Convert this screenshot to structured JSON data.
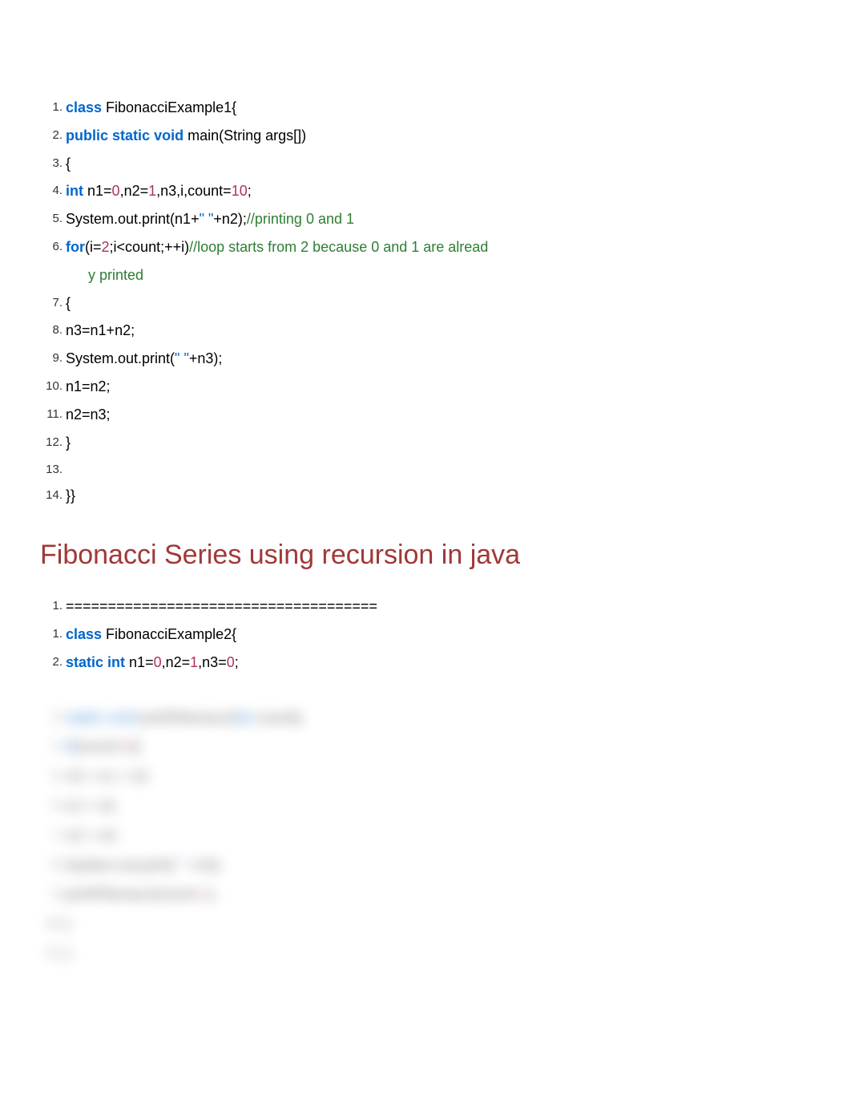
{
  "code_block_1": {
    "lines": [
      {
        "n": "1.",
        "tokens": [
          {
            "t": "class",
            "c": "kw"
          },
          {
            "t": " FibonacciExample1{",
            "c": ""
          }
        ]
      },
      {
        "n": "2.",
        "tokens": [
          {
            "t": "public",
            "c": "kw"
          },
          {
            "t": " ",
            "c": ""
          },
          {
            "t": "static",
            "c": "kw"
          },
          {
            "t": " ",
            "c": ""
          },
          {
            "t": "void",
            "c": "kw"
          },
          {
            "t": " main(String args[])",
            "c": ""
          }
        ]
      },
      {
        "n": "3.",
        "tokens": [
          {
            "t": " {",
            "c": ""
          }
        ]
      },
      {
        "n": "4.",
        "tokens": [
          {
            "t": " ",
            "c": ""
          },
          {
            "t": "int",
            "c": "kw"
          },
          {
            "t": " n1=",
            "c": ""
          },
          {
            "t": "0",
            "c": "num"
          },
          {
            "t": ",n2=",
            "c": ""
          },
          {
            "t": "1",
            "c": "num"
          },
          {
            "t": ",n3,i,count=",
            "c": ""
          },
          {
            "t": "10",
            "c": "num"
          },
          {
            "t": ";",
            "c": ""
          }
        ]
      },
      {
        "n": "5.",
        "tokens": [
          {
            "t": " System.out.print(n1+",
            "c": ""
          },
          {
            "t": "\" \"",
            "c": "str"
          },
          {
            "t": "+n2);",
            "c": ""
          },
          {
            "t": "//printing 0 and 1",
            "c": "comment"
          }
        ]
      },
      {
        "n": "6.",
        "tokens": [
          {
            "t": " ",
            "c": ""
          },
          {
            "t": "for",
            "c": "kw"
          },
          {
            "t": "(i=",
            "c": ""
          },
          {
            "t": "2",
            "c": "num"
          },
          {
            "t": ";i<count;++i)",
            "c": ""
          },
          {
            "t": "//loop starts from 2 because 0 and 1 are alread",
            "c": "comment"
          }
        ],
        "wrap": "y printed"
      },
      {
        "n": "7.",
        "tokens": [
          {
            "t": " {",
            "c": ""
          }
        ]
      },
      {
        "n": "8.",
        "tokens": [
          {
            "t": "  n3=n1+n2;",
            "c": ""
          }
        ]
      },
      {
        "n": "9.",
        "tokens": [
          {
            "t": "  System.out.print(",
            "c": ""
          },
          {
            "t": "\" \"",
            "c": "str"
          },
          {
            "t": "+n3);",
            "c": ""
          }
        ]
      },
      {
        "n": "10.",
        "tokens": [
          {
            "t": "  n1=n2;",
            "c": ""
          }
        ]
      },
      {
        "n": "11.",
        "tokens": [
          {
            "t": "  n2=n3;",
            "c": ""
          }
        ]
      },
      {
        "n": "12.",
        "tokens": [
          {
            "t": " }",
            "c": ""
          }
        ]
      },
      {
        "n": "13.",
        "tokens": [
          {
            "t": "",
            "c": ""
          }
        ]
      },
      {
        "n": "14.",
        "tokens": [
          {
            "t": "}}",
            "c": ""
          }
        ]
      }
    ]
  },
  "heading": "Fibonacci Series using recursion in java",
  "code_block_2": {
    "lines": [
      {
        "n": "1.",
        "tokens": [
          {
            "t": "=====================================",
            "c": ""
          }
        ]
      },
      {
        "n": "1.",
        "tokens": [
          {
            "t": "class",
            "c": "kw"
          },
          {
            "t": " FibonacciExample2{",
            "c": ""
          }
        ]
      },
      {
        "n": "2.",
        "tokens": [
          {
            "t": " ",
            "c": ""
          },
          {
            "t": "static",
            "c": "kw"
          },
          {
            "t": " ",
            "c": ""
          },
          {
            "t": "int",
            "c": "kw"
          },
          {
            "t": " n1=",
            "c": ""
          },
          {
            "t": "0",
            "c": "num"
          },
          {
            "t": ",n2=",
            "c": ""
          },
          {
            "t": "1",
            "c": "num"
          },
          {
            "t": ",n3=",
            "c": ""
          },
          {
            "t": "0",
            "c": "num"
          },
          {
            "t": ";",
            "c": ""
          }
        ]
      }
    ]
  },
  "blurred_block": {
    "lines": [
      {
        "n": "3.",
        "tokens": [
          {
            "t": " ",
            "c": ""
          },
          {
            "t": "static",
            "c": "kw"
          },
          {
            "t": " ",
            "c": ""
          },
          {
            "t": "void",
            "c": "kw"
          },
          {
            "t": " printFibonacci(",
            "c": ""
          },
          {
            "t": "int",
            "c": "kw"
          },
          {
            "t": " count){",
            "c": ""
          }
        ]
      },
      {
        "n": "4.",
        "tokens": [
          {
            "t": "    ",
            "c": ""
          },
          {
            "t": "if",
            "c": "kw"
          },
          {
            "t": "(count>",
            "c": ""
          },
          {
            "t": "0",
            "c": "num"
          },
          {
            "t": "){",
            "c": ""
          }
        ]
      },
      {
        "n": "5.",
        "tokens": [
          {
            "t": "         n3 = n1 + n2;",
            "c": ""
          }
        ]
      },
      {
        "n": "6.",
        "tokens": [
          {
            "t": "         n1 = n2;",
            "c": ""
          }
        ]
      },
      {
        "n": "7.",
        "tokens": [
          {
            "t": "         n2 = n3;",
            "c": ""
          }
        ]
      },
      {
        "n": "8.",
        "tokens": [
          {
            "t": "         System.out.print(",
            "c": ""
          },
          {
            "t": "\" \"",
            "c": "str"
          },
          {
            "t": "+n3);",
            "c": ""
          }
        ]
      },
      {
        "n": "9.",
        "tokens": [
          {
            "t": "         printFibonacci(count-",
            "c": ""
          },
          {
            "t": "1",
            "c": "num"
          },
          {
            "t": ");",
            "c": ""
          }
        ]
      },
      {
        "n": "10.",
        "tokens": [
          {
            "t": "     }",
            "c": ""
          }
        ]
      },
      {
        "n": "11.",
        "tokens": [
          {
            "t": " }",
            "c": ""
          }
        ]
      }
    ]
  }
}
